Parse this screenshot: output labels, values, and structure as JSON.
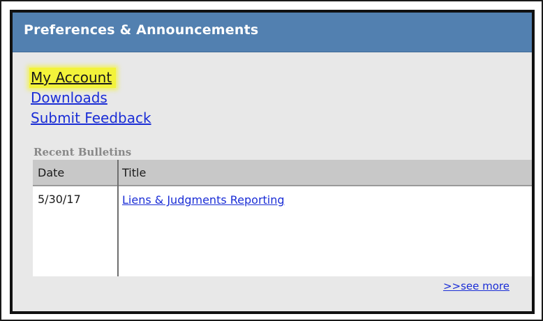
{
  "panel": {
    "title": "Preferences & Announcements"
  },
  "links": {
    "my_account": "My Account",
    "downloads": "Downloads",
    "submit_feedback": "Submit Feedback"
  },
  "bulletins": {
    "label": "Recent Bulletins",
    "columns": [
      "Date",
      "Title"
    ],
    "rows": [
      {
        "date": "5/30/17",
        "title": "Liens & Judgments Reporting"
      }
    ],
    "see_more": ">>see more"
  },
  "colors": {
    "header_blue": "#5280b0",
    "link_blue": "#1a2dd6",
    "highlight_yellow": "#f3f33a",
    "panel_gray": "#e8e8e8"
  }
}
